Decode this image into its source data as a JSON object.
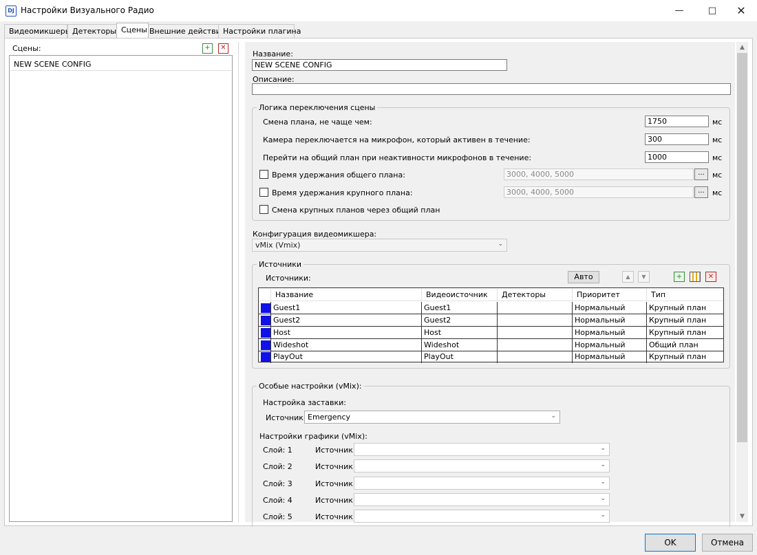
{
  "window": {
    "title": "Настройки Визуального Радио",
    "icon_text": "DJ"
  },
  "tabs": [
    "Видеомикшеры",
    "Детекторы",
    "Сцены",
    "Внешние действия",
    "Настройки плагина"
  ],
  "scenes": {
    "label": "Сцены:",
    "items": [
      "NEW SCENE CONFIG"
    ]
  },
  "form": {
    "name_label": "Название:",
    "name_value": "NEW SCENE CONFIG",
    "description_label": "Описание:",
    "description_value": ""
  },
  "switching": {
    "legend": "Логика переключения сцены",
    "unit": "мс",
    "rows": [
      {
        "label": "Смена плана, не чаще чем:",
        "value": "1750"
      },
      {
        "label": "Камера переключается на микрофон, который активен в течение:",
        "value": "300"
      },
      {
        "label": "Перейти на общий план при неактивности микрофонов в течение:",
        "value": "1000"
      }
    ],
    "hold_wide": {
      "label": "Время удержания общего плана:",
      "value": "3000, 4000, 5000",
      "button": "..."
    },
    "hold_close": {
      "label": "Время удержания крупного плана:",
      "value": "3000, 4000, 5000",
      "button": "..."
    },
    "via_wide_label": "Смена крупных планов через общий план"
  },
  "mixer_config": {
    "label": "Конфигурация видеомикшера:",
    "value": "vMix (Vmix)"
  },
  "sources": {
    "legend": "Источники",
    "label": "Источники:",
    "auto_button": "Авто",
    "up_icon": "▲",
    "down_icon": "▼",
    "columns": [
      "Название",
      "Видеоисточник",
      "Детекторы",
      "Приоритет",
      "Тип"
    ],
    "rows": [
      {
        "name": "Guest1",
        "video": "Guest1",
        "detectors": "",
        "priority": "Нормальный",
        "type": "Крупный план",
        "color": "#1010e8"
      },
      {
        "name": "Guest2",
        "video": "Guest2",
        "detectors": "",
        "priority": "Нормальный",
        "type": "Крупный план",
        "color": "#1010e8"
      },
      {
        "name": "Host",
        "video": "Host",
        "detectors": "",
        "priority": "Нормальный",
        "type": "Крупный план",
        "color": "#1010e8"
      },
      {
        "name": "Wideshot",
        "video": "Wideshot",
        "detectors": "",
        "priority": "Нормальный",
        "type": "Общий план",
        "color": "#1010e8"
      },
      {
        "name": "PlayOut",
        "video": "PlayOut",
        "detectors": "",
        "priority": "Нормальный",
        "type": "Крупный план",
        "color": "#1010e8"
      }
    ]
  },
  "special": {
    "legend": "Особые настройки (vMix):",
    "splash_label": "Настройка заставки:",
    "source_label": "Источник:",
    "splash_source": "Emergency",
    "graphics_label": "Настройки графики (vMix):",
    "layers": [
      {
        "label": "Слой: 1",
        "source_label": "Источник:"
      },
      {
        "label": "Слой: 2",
        "source_label": "Источник:"
      },
      {
        "label": "Слой: 3",
        "source_label": "Источник:"
      },
      {
        "label": "Слой: 4",
        "source_label": "Источник:"
      },
      {
        "label": "Слой: 5",
        "source_label": "Источник:"
      }
    ]
  },
  "footer": {
    "ok": "OK",
    "cancel": "Отмена"
  }
}
